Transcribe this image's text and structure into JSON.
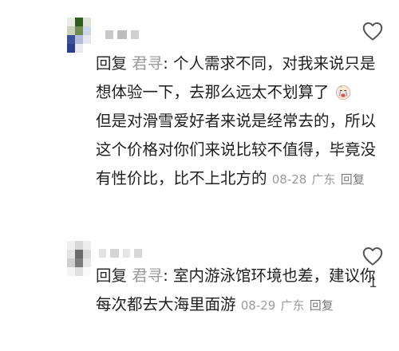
{
  "comments": [
    {
      "reply_label": "回复",
      "username": "君寻",
      "separator": ": ",
      "lines": [
        "个人需求不同，对我来说只是",
        "想体验一下，去那么远太不划算了",
        "但是对滑雪爱好者来说是经常去的，所以",
        "这个价格对你们来说比较不值得，毕竟没",
        "有性价比，比不上北方的"
      ],
      "emoji": "crying-face-emoji",
      "date": "08-28",
      "location": "广东",
      "reply_button": "回复"
    },
    {
      "reply_label": "回复",
      "username": "君寻",
      "separator": ": ",
      "lines": [
        "室内游泳馆环境也差，建议你",
        "每次都去大海里面游"
      ],
      "date": "08-29",
      "location": "广东",
      "reply_button": "回复",
      "like_count": "1"
    }
  ],
  "colors": {
    "text": "#1f1f1f",
    "muted": "#9a9a9a",
    "icon": "#555555"
  }
}
